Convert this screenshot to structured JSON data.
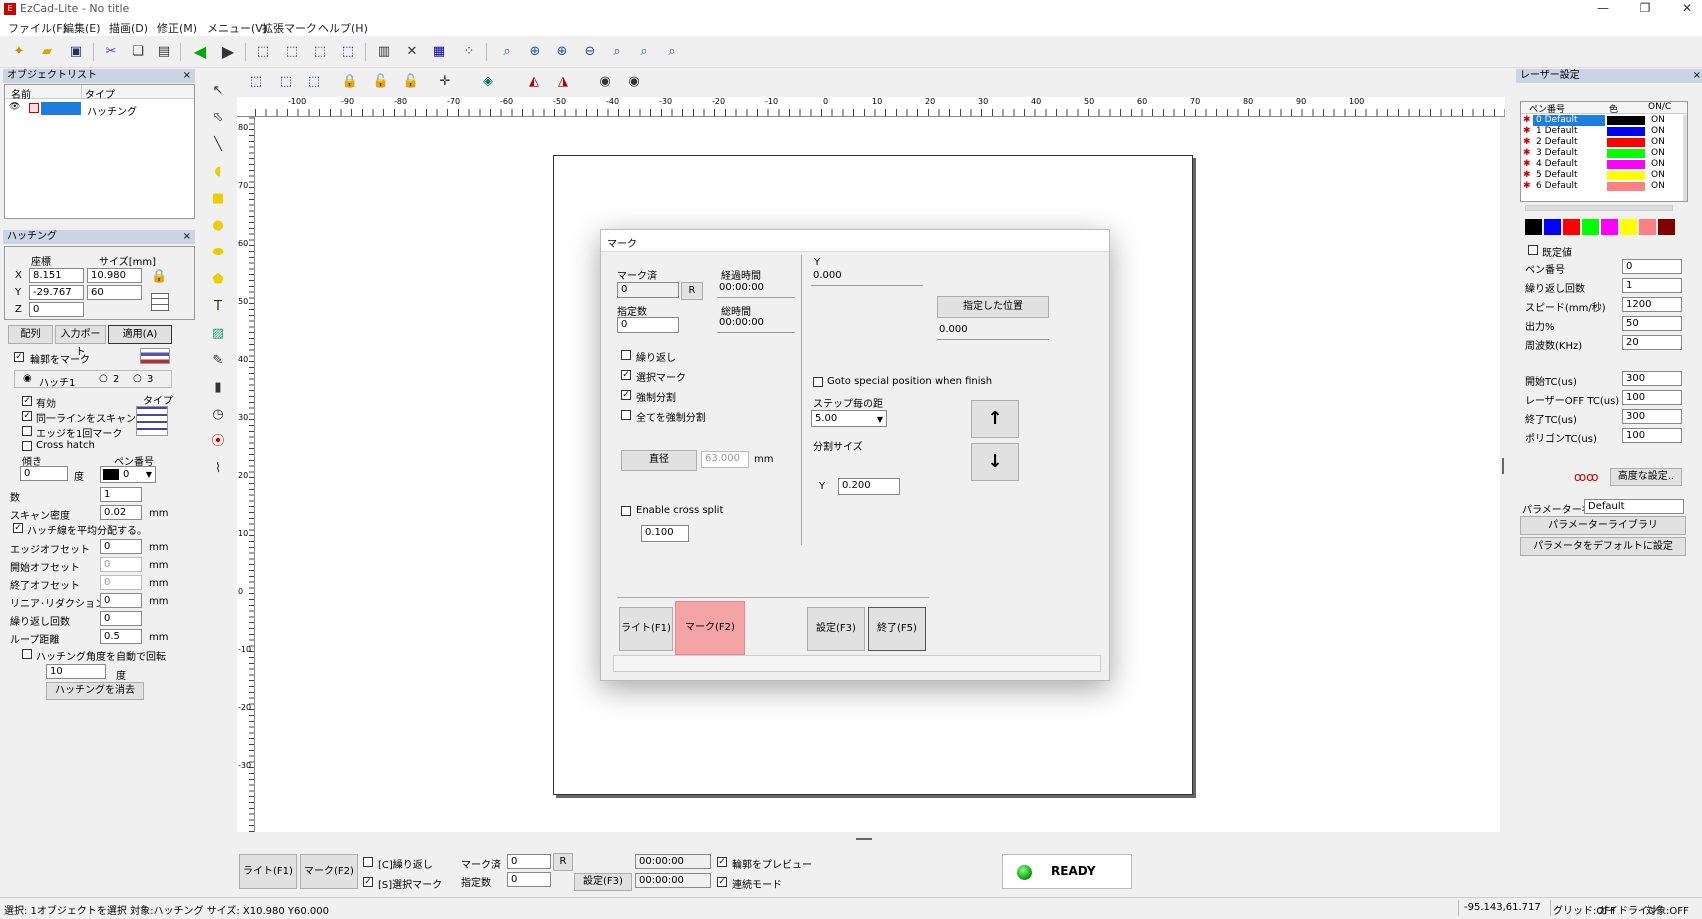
{
  "app": {
    "title": "EzCad-Lite - No title"
  },
  "menu": [
    "ファイル(F)",
    "編集(E)",
    "描画(D)",
    "修正(M)",
    "メニュー(V)",
    "拡張マーク",
    "ヘルプ(H)"
  ],
  "object_list": {
    "title": "オブジェクトリスト",
    "col_name": "名前",
    "col_type": "タイプ",
    "row_type": "ハッチング"
  },
  "hatch_panel": {
    "title": "ハッチング",
    "coord_label": "座標",
    "size_label": "サイズ[mm]",
    "x_label": "X",
    "x_val": "8.151",
    "x_size": "10.980",
    "y_label": "Y",
    "y_val": "-29.767",
    "y_size": "60",
    "z_label": "Z",
    "z_val": "0",
    "tab_array": "配列",
    "tab_import": "入力ポート",
    "apply": "適用(A)",
    "outline_mark": "輪郭をマーク",
    "hatch1": "ハッチ1",
    "hatch2": "2",
    "hatch3": "3",
    "enable": "有効",
    "type_label": "タイプ",
    "same_line": "同一ラインをスキャン",
    "edge_once": "エッジを1回マーク",
    "cross_hatch": "Cross hatch",
    "angle_label": "傾き",
    "pen_label": "ペン番号",
    "angle_val": "0",
    "angle_unit": "度",
    "pen_val": "0",
    "count_label": "数",
    "count_val": "1",
    "density_label": "スキャン密度",
    "density_val": "0.02",
    "mm": "mm",
    "distribute": "ハッチ線を平均分配する。",
    "edge_offset_label": "エッジオフセット",
    "edge_offset_val": "0",
    "start_offset_label": "開始オフセット",
    "start_offset_val": "0",
    "end_offset_label": "終了オフセット",
    "end_offset_val": "0",
    "linear_label": "リニア･リダクション",
    "linear_val": "0",
    "repeat_label": "繰り返し回数",
    "repeat_val": "0",
    "loop_label": "ループ距離",
    "loop_val": "0.5",
    "auto_rotate": "ハッチング角度を自動で回転",
    "rotate_val": "10",
    "rotate_unit": "度",
    "delete_btn": "ハッチングを消去"
  },
  "ruler_h": [
    "-100",
    "-90",
    "-80",
    "-70",
    "-60",
    "-50",
    "-40",
    "-30",
    "-20",
    "-10",
    "0",
    "10",
    "20",
    "30",
    "40",
    "50",
    "60",
    "70",
    "80",
    "90",
    "100"
  ],
  "ruler_v": [
    "80",
    "70",
    "60",
    "50",
    "40",
    "30",
    "20",
    "10",
    "0",
    "-10",
    "-20",
    "-30",
    "-40",
    "-50",
    "-60",
    "-70",
    "-80"
  ],
  "dialog": {
    "title": "マーク",
    "marked_label": "マーク済",
    "marked_val": "0",
    "reset": "R",
    "elapsed_label": "経過時間",
    "elapsed_val": "00:00:00",
    "specified_label": "指定数",
    "specified_val": "0",
    "total_label": "総時間",
    "total_val": "00:00:00",
    "repeat": "繰り返し",
    "select_mark": "選択マーク",
    "force_split": "強制分割",
    "all_split": "全てを強制分割",
    "diameter_btn": "直径",
    "diameter_val": "63.000",
    "mm": "mm",
    "cross_split": "Enable cross split",
    "cross_val": "0.100",
    "y_label": "Y",
    "y_val": "0.000",
    "goto_btn": "指定した位置",
    "goto_val": "0.000",
    "goto_special": "Goto special position when finish",
    "step_label": "ステップ毎の距",
    "step_val": "5.00",
    "split_label": "分割サイズ",
    "split_y_label": "Y",
    "split_y_val": "0.200",
    "up_arrow": "↑",
    "down_arrow": "↓",
    "light_btn": "ライト(F1)",
    "mark_btn": "マーク(F2)",
    "settings_btn": "設定(F3)",
    "exit_btn": "終了(F5)"
  },
  "laser": {
    "title": "レーザー設定",
    "col_pen": "ペン番号",
    "col_color": "色",
    "col_onoff": "ON/C",
    "pens": [
      {
        "name": "0 Default",
        "color": "#000000",
        "on": "ON"
      },
      {
        "name": "1 Default",
        "color": "#0000ff",
        "on": "ON"
      },
      {
        "name": "2 Default",
        "color": "#ff0000",
        "on": "ON"
      },
      {
        "name": "3 Default",
        "color": "#00ff00",
        "on": "ON"
      },
      {
        "name": "4 Default",
        "color": "#ff00ff",
        "on": "ON"
      },
      {
        "name": "5 Default",
        "color": "#ffff00",
        "on": "ON"
      },
      {
        "name": "6 Default",
        "color": "#ff8080",
        "on": "ON"
      }
    ],
    "palette": [
      "#000000",
      "#0000ff",
      "#ff0000",
      "#00ff00",
      "#ff00ff",
      "#ffff00",
      "#ff8080",
      "#800000"
    ],
    "default_val": "既定値",
    "pen_no_label": "ペン番号",
    "pen_no_val": "0",
    "loop_label": "繰り返し回数",
    "loop_val": "1",
    "speed_label": "スピード(mm/秒)",
    "speed_val": "1200",
    "power_label": "出力%",
    "power_val": "50",
    "freq_label": "周波数(KHz)",
    "freq_val": "20",
    "start_tc_label": "開始TC(us)",
    "start_tc_val": "300",
    "off_tc_label": "レーザーOFF TC(us)",
    "off_tc_val": "100",
    "end_tc_label": "終了TC(us)",
    "end_tc_val": "300",
    "poly_tc_label": "ポリゴンTC(us)",
    "poly_tc_val": "100",
    "advanced": "高度な設定..",
    "param_name_label": "パラメーター名",
    "param_name_val": "Default",
    "library_btn": "パラメーターライブラリ",
    "default_btn": "パラメータをデフォルトに設定"
  },
  "bottom": {
    "light": "ライト(F1)",
    "mark": "マーク(F2)",
    "repeat": "[C]繰り返し",
    "select": "[S]選択マーク",
    "marked_label": "マーク済",
    "marked_val": "0",
    "reset": "R",
    "specified_label": "指定数",
    "specified_val": "0",
    "settings": "設定(F3)",
    "time1": "00:00:00",
    "time2": "00:00:00",
    "preview": "輪郭をプレビュー",
    "continuous": "連続モード",
    "ready": "READY"
  },
  "status": {
    "left": "選択: 1オブジェクトを選択 対象:ハッチング サイズ: X10.980 Y60.000",
    "coords": "-95.143,61.717",
    "grid": "グリッド:OFF",
    "guide": "ガイドライン",
    "snap": "対象:OFF"
  }
}
